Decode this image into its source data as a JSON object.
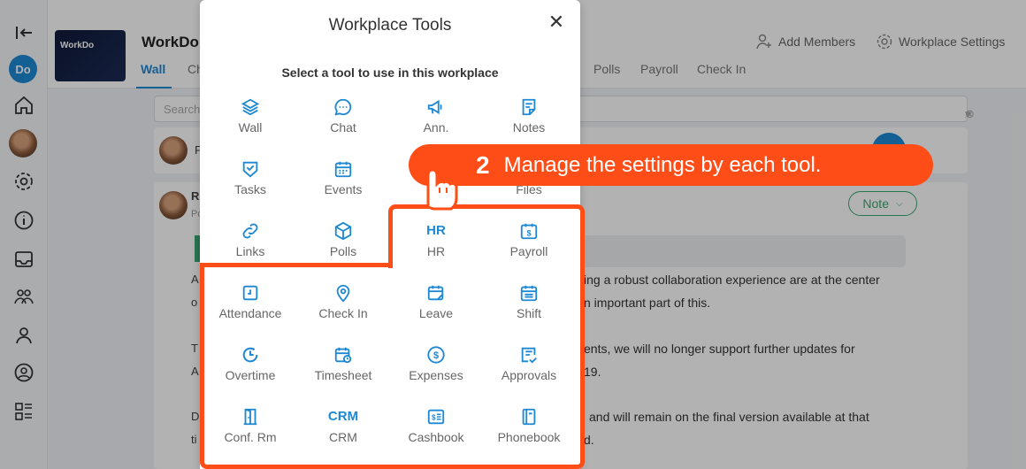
{
  "rail": {
    "workspace_initials": "Do",
    "icons": [
      "collapse-icon",
      "home-icon",
      "settings-icon",
      "info-icon",
      "inbox-icon",
      "groups-icon",
      "contacts-icon",
      "support-icon",
      "apps-icon"
    ]
  },
  "header": {
    "workspace_name": "WorkDo",
    "thumb_title": "WorkDo",
    "tabs": [
      "Wall",
      "Ch",
      "Polls",
      "Payroll",
      "Check In"
    ],
    "add_members": "Add Members",
    "workplace_settings": "Workplace Settings"
  },
  "content": {
    "search_placeholder": "Search",
    "note_label": "Note",
    "post1_frag": "R",
    "post1_sub": "Po",
    "para1_a": "ing a robust collaboration experience are at the center",
    "para1_b": "n important part of this.",
    "para2_a": "ents, we will no longer support further updates for",
    "para2_b": "19.",
    "para3_a": "and will remain on the final version available at that",
    "para3_b": "d.",
    "left_frags": [
      "A",
      "o",
      "T",
      "A",
      "D",
      "ti",
      "F"
    ]
  },
  "modal": {
    "title": "Workplace Tools",
    "subtitle": "Select a tool to use in this workplace",
    "tools": [
      {
        "label": "Wall",
        "icon": "layers-icon"
      },
      {
        "label": "Chat",
        "icon": "chat-icon"
      },
      {
        "label": "Ann.",
        "icon": "megaphone-icon"
      },
      {
        "label": "Notes",
        "icon": "notes-icon"
      },
      {
        "label": "Tasks",
        "icon": "tasks-icon"
      },
      {
        "label": "Events",
        "icon": "calendar-icon"
      },
      {
        "label": "Files",
        "icon": "files-icon"
      },
      {
        "label": "Links",
        "icon": "link-icon"
      },
      {
        "label": "Polls",
        "icon": "cube-icon"
      },
      {
        "label": "HR",
        "icon_text": "HR"
      },
      {
        "label": "Payroll",
        "icon": "payroll-icon"
      },
      {
        "label": "Attendance",
        "icon": "attendance-icon"
      },
      {
        "label": "Check In",
        "icon": "location-pin-icon"
      },
      {
        "label": "Leave",
        "icon": "leave-calendar-icon"
      },
      {
        "label": "Shift",
        "icon": "shift-icon"
      },
      {
        "label": "Overtime",
        "icon": "clock-icon"
      },
      {
        "label": "Timesheet",
        "icon": "timesheet-icon"
      },
      {
        "label": "Expenses",
        "icon": "dollar-circle-icon"
      },
      {
        "label": "Approvals",
        "icon": "approvals-icon"
      },
      {
        "label": "Conf. Rm",
        "icon": "door-icon"
      },
      {
        "label": "CRM",
        "icon_text": "CRM"
      },
      {
        "label": "Cashbook",
        "icon": "cashbook-icon"
      },
      {
        "label": "Phonebook",
        "icon": "phonebook-icon"
      }
    ]
  },
  "callout": {
    "step": "2",
    "message": "Manage the settings by each tool."
  },
  "colors": {
    "accent": "#1e88d3",
    "highlight": "#ff4d17",
    "success": "#3aa673"
  }
}
